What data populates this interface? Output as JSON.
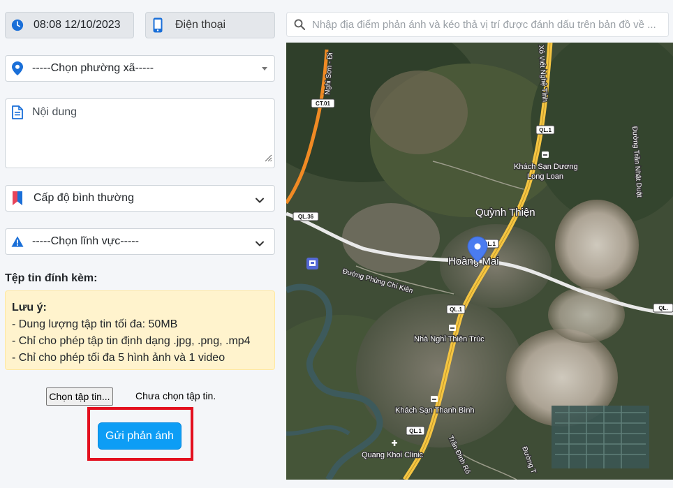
{
  "header": {
    "datetime": "08:08 12/10/2023",
    "phone_label": "Điện thoại"
  },
  "form": {
    "ward_select": "-----Chọn phường xã-----",
    "content_placeholder": "Nội dung",
    "level_select": "Cấp độ bình thường",
    "field_select": "-----Chọn lĩnh vực-----",
    "attachment_label": "Tệp tin đính kèm:",
    "note": {
      "title": "Lưu ý:",
      "lines": [
        "- Dung lượng tập tin tối đa: 50MB",
        "- Chỉ cho phép tập tin định dạng .jpg, .png, .mp4",
        "- Chỉ cho phép tối đa 5 hình ảnh và 1 video"
      ]
    },
    "choose_file_label": "Chọn tập tin...",
    "no_file_label": "Chưa chọn tập tin.",
    "submit_label": "Gửi phản ánh"
  },
  "search": {
    "placeholder": "Nhập địa điểm phản ánh và kéo thả vị trí được đánh dấu trên bản đồ về ..."
  },
  "map": {
    "place_labels": {
      "quynh_thien": "Quỳnh Thiện",
      "hoang_mai": "Hoàng Mai",
      "khach_san_duong_long_loan_1": "Khách Sạn Dương",
      "khach_san_duong_long_loan_2": "Long Loan",
      "nha_nghi_thien_truc": "Nhà Nghỉ Thiên Trúc",
      "khach_san_thanh_binh": "Khách Sạn Thanh Bình",
      "quang_khoi_clinic": "Quang Khoi Clinic"
    },
    "road_labels": {
      "nghi_son_dinh": "Nghi Sơn - Đi",
      "xo_viet_nghe_tinh": "Xô Viết Nghệ Tĩnh",
      "tran_nhat_duat": "Đường Trần Nhật Duật",
      "phung_chi_kien": "Đường Phùng Chí Kiên",
      "tran_dinh_ro": "Trần Đình Rô",
      "duong_t": "Đường T"
    },
    "shields": {
      "ct01": "CT.01",
      "ql1_a": "QL.1",
      "ql36": "QL.36",
      "ql1_b": "QL.1",
      "ql1_c": "QL.1",
      "ql1_d": "QL.1",
      "ql_e": "QL."
    }
  },
  "colors": {
    "submit_button": "#0d9df5",
    "highlight_frame": "#e3101f",
    "note_background": "#fff3cd",
    "map_marker": "#4a7cf0",
    "highway": "#f5c542",
    "secondary_road": "#f08a24"
  }
}
